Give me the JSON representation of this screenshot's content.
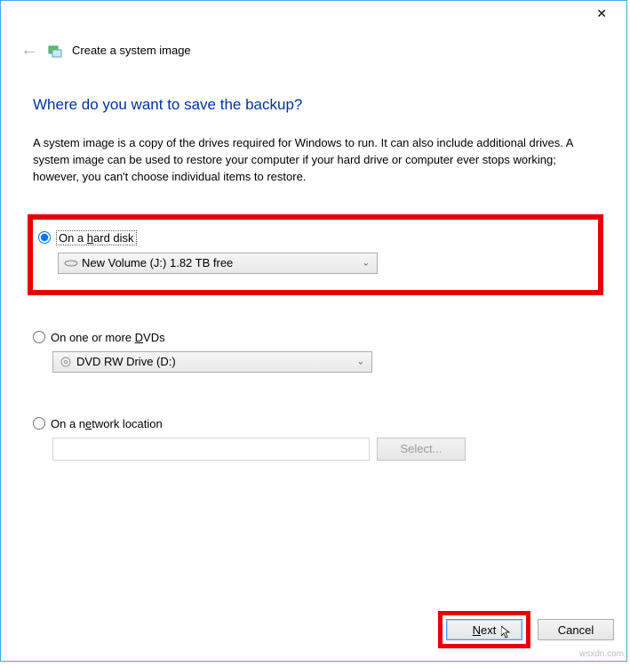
{
  "titlebar": {
    "close": "✕"
  },
  "header": {
    "back_arrow": "←",
    "title": "Create a system image"
  },
  "main": {
    "heading": "Where do you want to save the backup?",
    "description": "A system image is a copy of the drives required for Windows to run. It can also include additional drives. A system image can be used to restore your computer if your hard drive or computer ever stops working; however, you can't choose individual items to restore."
  },
  "options": {
    "hard_disk": {
      "label_pre": "On a ",
      "label_key": "h",
      "label_post": "ard disk",
      "selected": "New Volume (J:)  1.82 TB free"
    },
    "dvd": {
      "label_pre": "On one or more ",
      "label_key": "D",
      "label_post": "VDs",
      "selected": "DVD RW Drive (D:)"
    },
    "network": {
      "label_pre": "On a n",
      "label_key": "e",
      "label_post": "twork location",
      "select_button": "Select..."
    }
  },
  "footer": {
    "next_pre": "",
    "next_key": "N",
    "next_post": "ext",
    "cancel": "Cancel"
  },
  "watermark": "wsxdn.com"
}
